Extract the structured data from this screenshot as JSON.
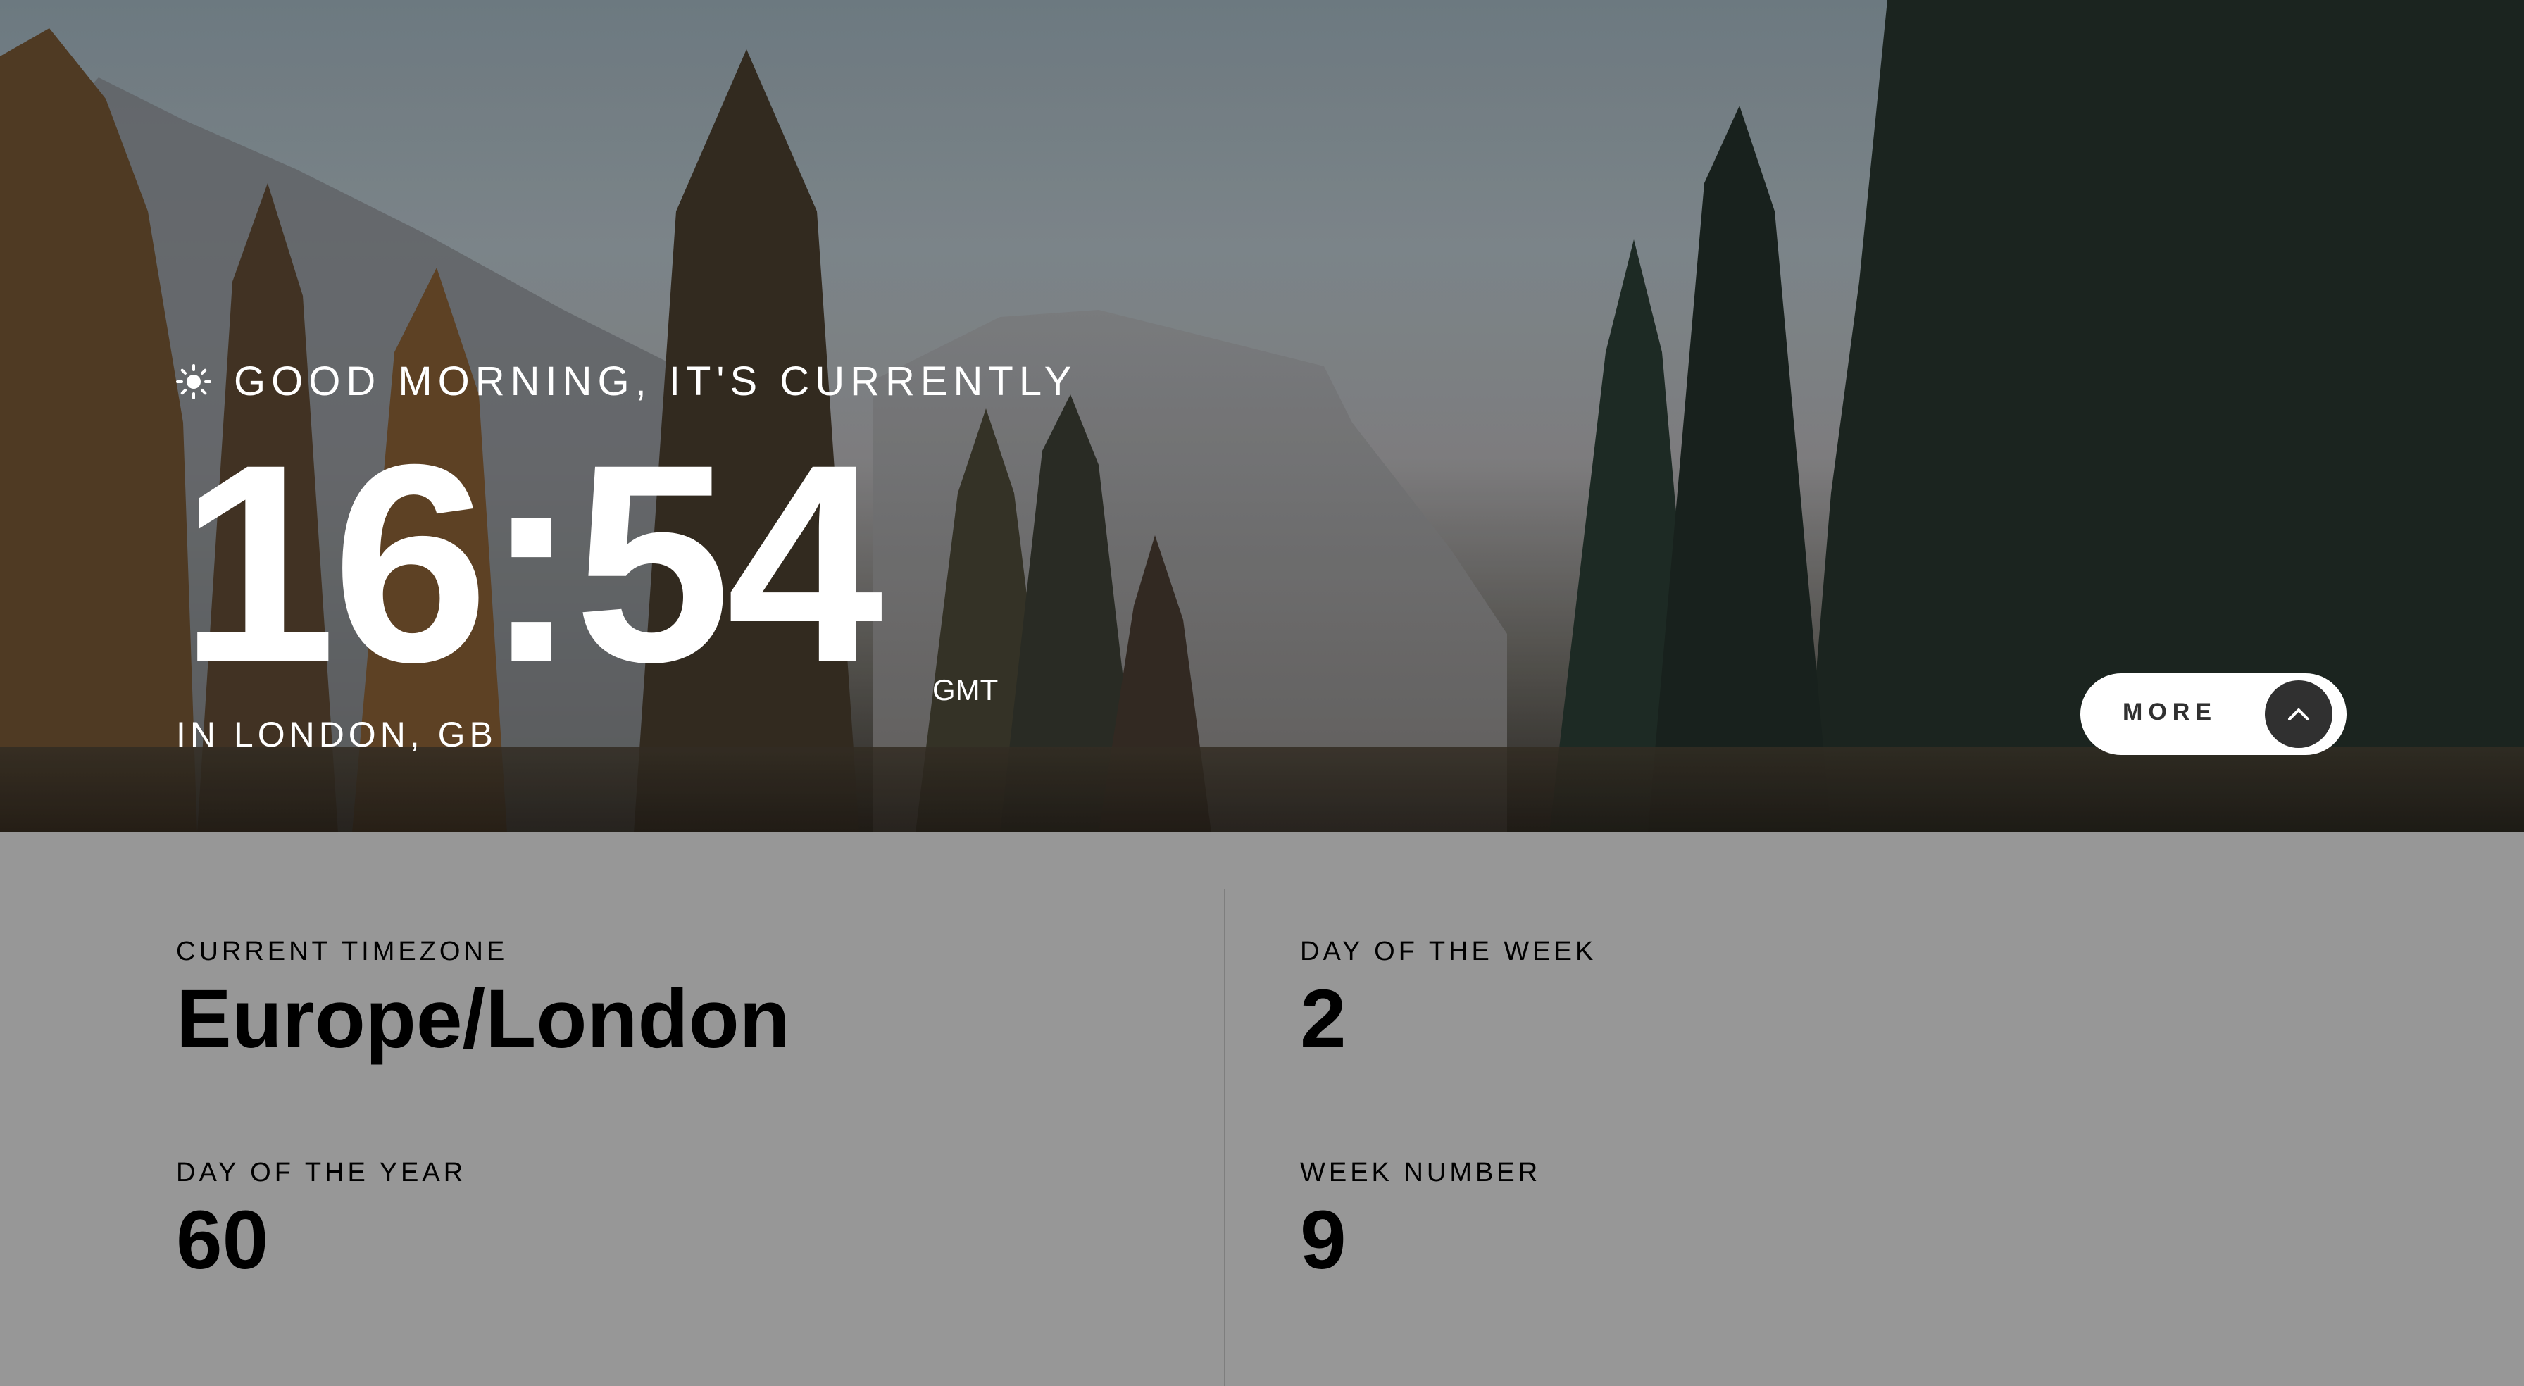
{
  "hero": {
    "greeting": "GOOD MORNING, IT'S CURRENTLY",
    "greeting_icon": "sun-icon",
    "time": "16:54",
    "timezone_abbreviation": "GMT",
    "location": "IN LONDON, GB",
    "more_button": {
      "label": "MORE",
      "icon": "chevron-up-icon"
    }
  },
  "details": {
    "current_timezone": {
      "label": "CURRENT TIMEZONE",
      "value": "Europe/London"
    },
    "day_of_week": {
      "label": "DAY OF THE WEEK",
      "value": "2"
    },
    "day_of_year": {
      "label": "DAY OF THE YEAR",
      "value": "60"
    },
    "week_number": {
      "label": "WEEK NUMBER",
      "value": "9"
    }
  },
  "colors": {
    "panel_background": "#979797",
    "text_light": "#ffffff",
    "text_dark": "#000000",
    "button_background": "#ffffff",
    "button_icon_background": "#303030"
  }
}
